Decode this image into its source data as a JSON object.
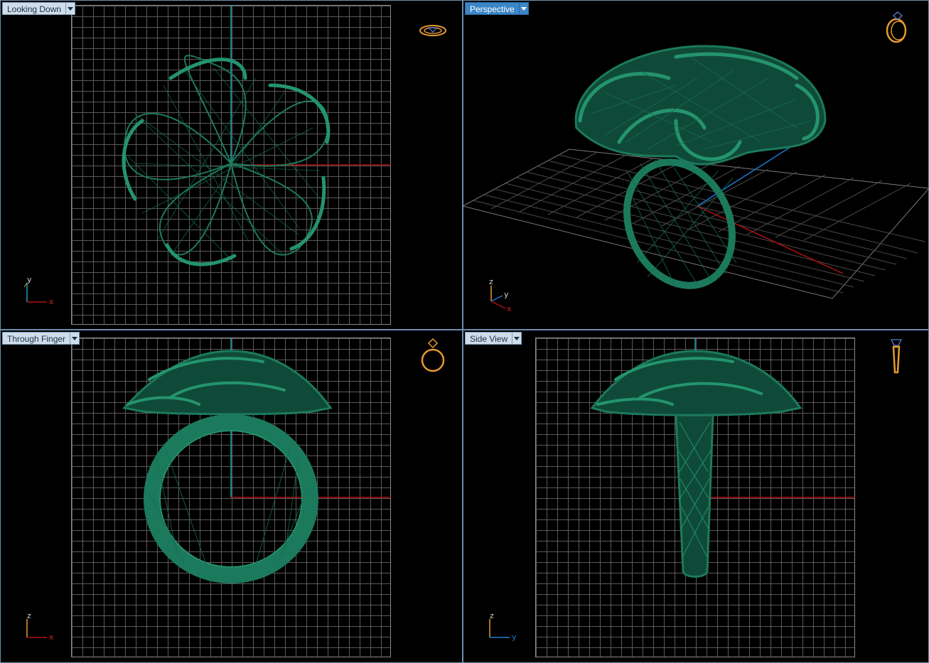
{
  "viewports": [
    {
      "id": "top",
      "label": "Looking Down",
      "active": false
    },
    {
      "id": "persp",
      "label": "Perspective",
      "active": true
    },
    {
      "id": "front",
      "label": "Through Finger",
      "active": false
    },
    {
      "id": "side",
      "label": "Side View",
      "active": false
    }
  ],
  "axes": {
    "top": {
      "vertical": "y",
      "horizontal": "x"
    },
    "persp": {
      "a": "z",
      "b": "y",
      "c": "x"
    },
    "front": {
      "vertical": "z",
      "horizontal": "x"
    },
    "side": {
      "vertical": "z",
      "horizontal": "y"
    }
  },
  "icons": {
    "top": "ring-top-view-icon",
    "persp": "ring-perspective-icon",
    "front": "ring-front-view-icon",
    "side": "ring-side-view-icon"
  },
  "colors": {
    "model": "#1c7a5c",
    "grid": "#5a5a5a",
    "x_axis": "#b01010",
    "y_axis": "#1aa3b8",
    "icon": "#e69a2e",
    "active_tab": "#3b86c6",
    "border": "#6a8fae"
  }
}
